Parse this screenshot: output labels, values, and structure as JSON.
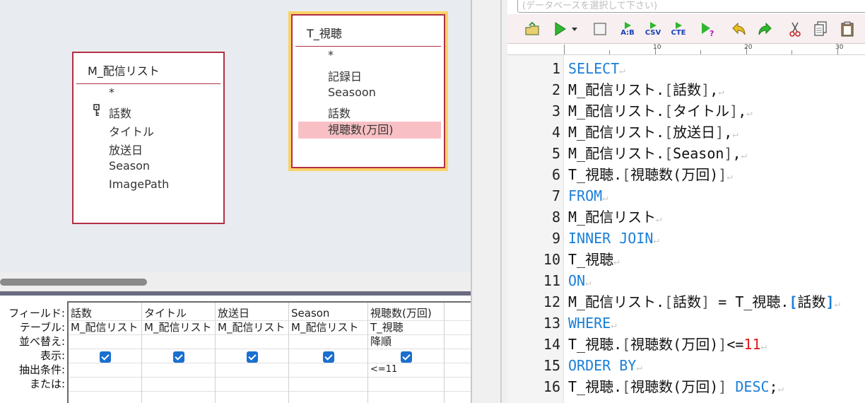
{
  "designer": {
    "table_m": {
      "title": "M_配信リスト",
      "fields": [
        "*",
        "話数",
        "タイトル",
        "放送日",
        "Season",
        "ImagePath"
      ]
    },
    "table_t": {
      "title": "T_視聴",
      "fields": [
        "*",
        "記録日",
        "Seasoon",
        "話数",
        "視聴数(万回)"
      ]
    },
    "grid": {
      "row_labels": [
        "フィールド:",
        "テーブル:",
        "並べ替え:",
        "表示:",
        "抽出条件:",
        "または:"
      ],
      "columns": [
        {
          "field": "話数",
          "table": "M_配信リスト",
          "sort": "",
          "show": true,
          "criteria": ""
        },
        {
          "field": "タイトル",
          "table": "M_配信リスト",
          "sort": "",
          "show": true,
          "criteria": ""
        },
        {
          "field": "放送日",
          "table": "M_配信リスト",
          "sort": "",
          "show": true,
          "criteria": ""
        },
        {
          "field": "Season",
          "table": "M_配信リスト",
          "sort": "",
          "show": true,
          "criteria": ""
        },
        {
          "field": "視聴数(万回)",
          "table": "T_視聴",
          "sort": "降順",
          "show": true,
          "criteria": "<=11"
        }
      ]
    }
  },
  "editor": {
    "db_placeholder": "(データベースを選択して下さい)",
    "toolbar": {
      "ab": "A:B",
      "csv": "CSV",
      "cte": "CTE"
    },
    "ruler": [
      "10",
      "20",
      "30"
    ],
    "lines": [
      {
        "n": "1",
        "text": "SELECT"
      },
      {
        "n": "2",
        "text": "M_配信リスト.[話数],"
      },
      {
        "n": "3",
        "text": "M_配信リスト.[タイトル],"
      },
      {
        "n": "4",
        "text": "M_配信リスト.[放送日],"
      },
      {
        "n": "5",
        "text": "M_配信リスト.[Season],"
      },
      {
        "n": "6",
        "text": "T_視聴.[視聴数(万回)]"
      },
      {
        "n": "7",
        "text": "FROM"
      },
      {
        "n": "8",
        "text": "M_配信リスト"
      },
      {
        "n": "9",
        "text": "INNER JOIN"
      },
      {
        "n": "10",
        "text": "T_視聴"
      },
      {
        "n": "11",
        "text": "ON"
      },
      {
        "n": "12",
        "text": "M_配信リスト.[話数] = T_視聴.[話数]"
      },
      {
        "n": "13",
        "text": "WHERE"
      },
      {
        "n": "14",
        "text": "T_視聴.[視聴数(万回)]<=11"
      },
      {
        "n": "15",
        "text": "ORDER BY"
      },
      {
        "n": "16",
        "text": "T_視聴.[視聴数(万回)] DESC;"
      }
    ]
  },
  "colors": {
    "keyword": "#1a7fd8",
    "number": "#e01818",
    "table_border": "#b03046",
    "selected_table_frame": "#fbd268",
    "highlight_field": "#f8c0c4",
    "checkbox": "#1a6fcf"
  }
}
